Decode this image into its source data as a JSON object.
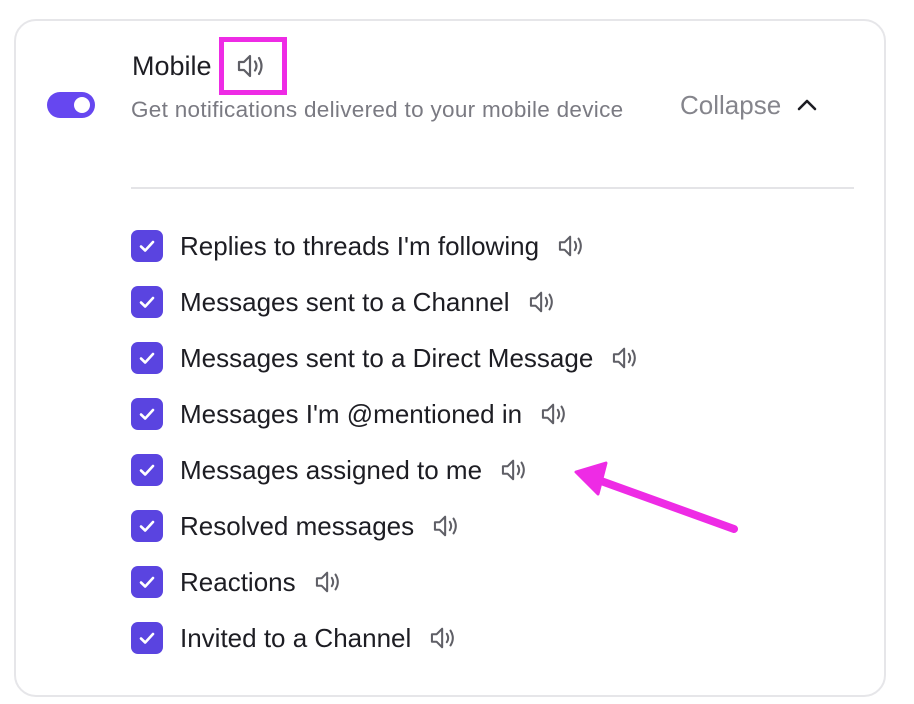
{
  "section": {
    "title": "Mobile",
    "subtitle": "Get notifications delivered to your mobile device",
    "enabled": true,
    "collapse_label": "Collapse"
  },
  "colors": {
    "accent": "#5a44e0",
    "toggle": "#6647f0",
    "annotation": "#ee2be5",
    "text": "#1d1d23",
    "muted_text": "#7a7a82"
  },
  "icons": {
    "sound": "speaker-icon",
    "collapse": "chevron-up-icon",
    "checkbox": "checkmark-icon"
  },
  "options": [
    {
      "label": "Replies to threads I'm following",
      "checked": true
    },
    {
      "label": "Messages sent to a Channel",
      "checked": true
    },
    {
      "label": "Messages sent to a Direct Message",
      "checked": true
    },
    {
      "label": "Messages I'm @mentioned in",
      "checked": true
    },
    {
      "label": "Messages assigned to me",
      "checked": true
    },
    {
      "label": "Resolved messages",
      "checked": true
    },
    {
      "label": "Reactions",
      "checked": true
    },
    {
      "label": "Invited to a Channel",
      "checked": true
    }
  ]
}
